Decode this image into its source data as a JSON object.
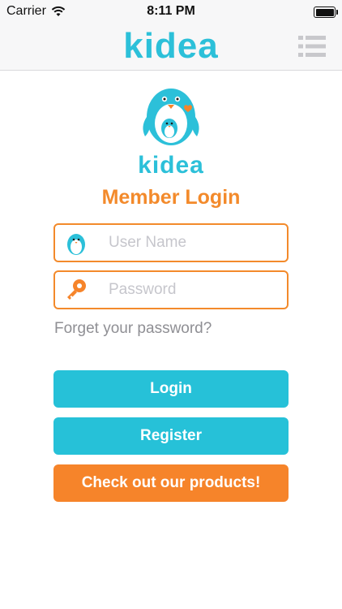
{
  "status_bar": {
    "carrier": "Carrier",
    "time": "8:11 PM"
  },
  "nav": {
    "logo": "kidea",
    "menu_icon": "hamburger-menu-icon"
  },
  "logo": {
    "word": "kidea",
    "icon": "penguin-family-logo"
  },
  "login": {
    "title": "Member Login",
    "username": {
      "placeholder": "User Name",
      "value": "",
      "icon": "penguin-icon"
    },
    "password": {
      "placeholder": "Password",
      "value": "",
      "icon": "key-icon"
    },
    "forgot": "Forget your password?"
  },
  "buttons": {
    "login": "Login",
    "register": "Register",
    "products": "Check out our products!"
  },
  "colors": {
    "teal": "#26c1d8",
    "orange": "#f6842a",
    "logo_blue": "#2cc0d9"
  }
}
